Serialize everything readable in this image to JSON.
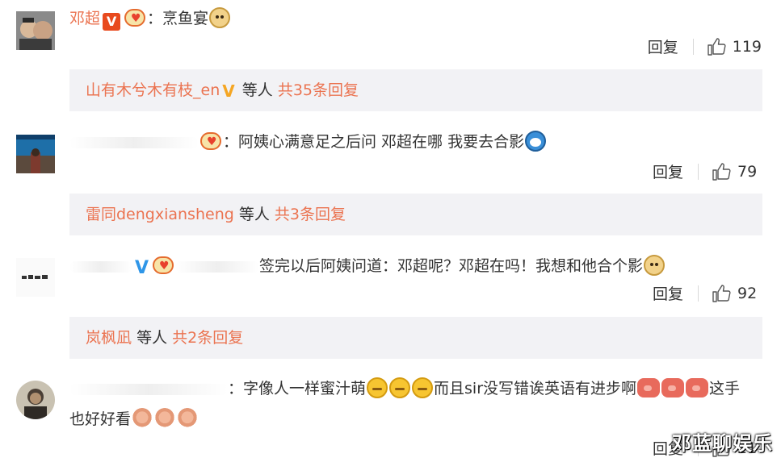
{
  "comments": [
    {
      "user": "邓超",
      "text": "：烹鱼宴",
      "reply_label": "回复",
      "likes": "119",
      "reply_summary": {
        "prefix": "山有木兮木有枝_en",
        "middle": "等人",
        "link": "共35条回复"
      }
    },
    {
      "user": "",
      "text": "：阿姨心满意足之后问 邓超在哪 我要去合影",
      "reply_label": "回复",
      "likes": "79",
      "reply_summary": {
        "prefix": "雷同dengxiansheng",
        "middle": "等人",
        "link": "共3条回复"
      }
    },
    {
      "user": "",
      "text": "签完以后阿姨问道：邓超呢？邓超在吗！我想和他合个影",
      "reply_label": "回复",
      "likes": "92",
      "reply_summary": {
        "prefix": "岚枫凪",
        "middle": "等人",
        "link": "共2条回复"
      }
    },
    {
      "user": "",
      "text_a": "：字像人一样蜜汁萌",
      "text_b": "而且sir没写错诶英语有进步啊",
      "text_c": "这手",
      "text_line2": "也好好看",
      "reply_label": "回复",
      "likes": "21"
    }
  ],
  "watermark": "邓蓝聊娱乐",
  "colors": {
    "name": "#eb7350",
    "reply_bar_bg": "#f2f2f5",
    "text": "#333333"
  },
  "icons": [
    "like-icon",
    "verified-badge-icon",
    "fan-badge-icon",
    "doge-emoji-icon",
    "doraemon-emoji-icon",
    "cry-emoji-icon",
    "pig-emoji-icon",
    "flower-emoji-icon"
  ]
}
